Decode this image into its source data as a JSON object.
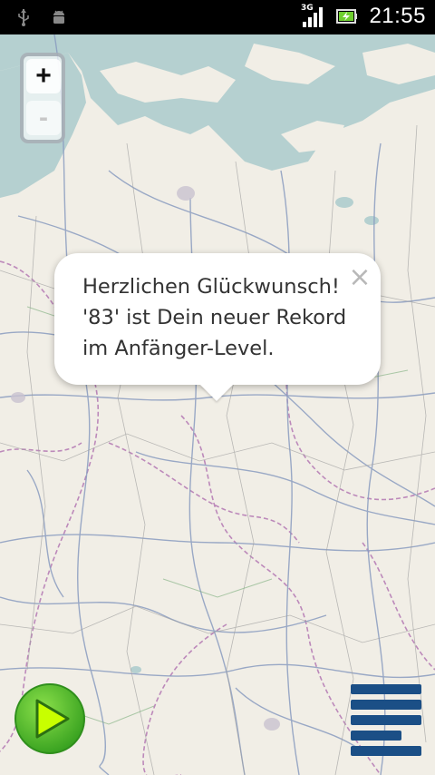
{
  "status_bar": {
    "time": "21:55",
    "network_type": "3G",
    "icons": [
      "usb-icon",
      "android-debug-icon",
      "signal-icon",
      "battery-charging-icon"
    ]
  },
  "map": {
    "zoom_in_label": "+",
    "zoom_out_label": "-"
  },
  "popup": {
    "lines": [
      "Herzlichen Glückwunsch!",
      "'83' ist Dein neuer Rekord",
      "im Anfänger-Level."
    ],
    "close_label": "×"
  },
  "controls": {
    "play_icon": "play-icon",
    "menu_icon": "menu-icon",
    "play_color": "#5bc22a",
    "menu_color": "#1b4f86"
  }
}
